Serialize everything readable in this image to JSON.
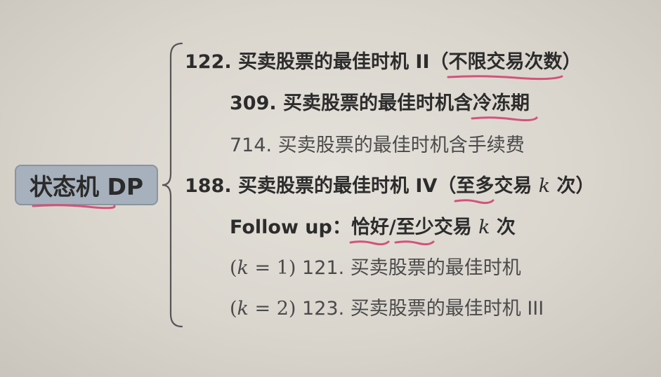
{
  "root": {
    "label": "状态机 DP"
  },
  "items": [
    {
      "prefix": "122. 买卖股票的最佳时机 II（",
      "highlight": "不限交易次数",
      "suffix": "）"
    },
    {
      "prefix": "309. 买卖股票的最佳时机含",
      "highlight": "冷冻期"
    },
    {
      "text": "714. 买卖股票的最佳时机含手续费"
    },
    {
      "prefix": "188. 买卖股票的最佳时机 IV（",
      "highlight": "至多",
      "middle": "交易 ",
      "k": "k",
      "suffix": " 次）"
    },
    {
      "prefix": "Follow up：",
      "highlight1": "恰好",
      "slash": "/",
      "highlight2": "至少",
      "middle": "交易 ",
      "k": "k",
      "suffix": " 次"
    },
    {
      "open": "(",
      "k": "k",
      "eq": " = ",
      "num": "1",
      "close": ")",
      "text": " 121. 买卖股票的最佳时机"
    },
    {
      "open": "(",
      "k": "k",
      "eq": " = ",
      "num": "2",
      "close": ")",
      "text": " 123. 买卖股票的最佳时机 III"
    }
  ],
  "colors": {
    "underline": "#d3537a",
    "root_fill": "#a7b1bd",
    "brace": "#555555"
  }
}
